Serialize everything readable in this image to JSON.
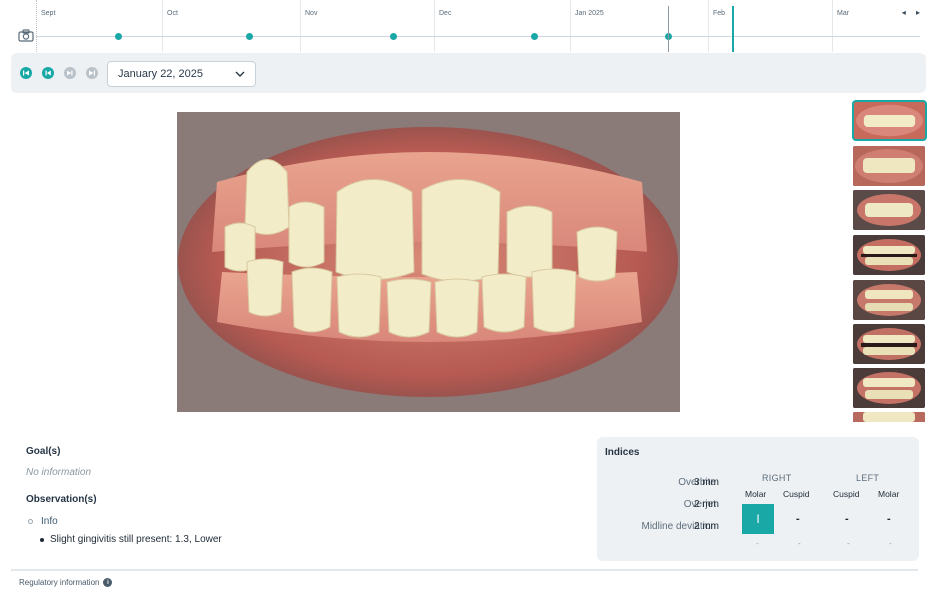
{
  "timeline": {
    "months": [
      "Sept",
      "Oct",
      "Nov",
      "Dec",
      "Jan 2025",
      "Feb",
      "Mar"
    ],
    "nav_arrows": "◂ ▸",
    "camera_icon": "camera-icon"
  },
  "toolbar": {
    "selected_date": "January 22, 2025",
    "controls": [
      "first-icon",
      "previous-icon",
      "next-icon",
      "last-icon"
    ]
  },
  "goals": {
    "title": "Goal(s)",
    "value": "No information"
  },
  "observations": {
    "title": "Observation(s)",
    "category": "Info",
    "items": [
      "Slight gingivitis still present: 1.3, Lower"
    ]
  },
  "indices": {
    "title": "Indices",
    "rows": [
      {
        "label": "Overbite",
        "value": "3 mm"
      },
      {
        "label": "Overjet",
        "value": "2 mm"
      },
      {
        "label": "Midline deviation",
        "value": "2 mm"
      }
    ],
    "right_label": "RIGHT",
    "left_label": "LEFT",
    "columns": [
      "Molar",
      "Cuspid",
      "Cuspid",
      "Molar"
    ],
    "class_values": [
      "I",
      "-",
      "-",
      "-"
    ],
    "sub_values": [
      "-",
      "-",
      "-",
      "-"
    ]
  },
  "footer": {
    "regulatory": "Regulatory information"
  },
  "colors": {
    "accent": "#1aa8a6",
    "panel": "#eef1f4"
  }
}
